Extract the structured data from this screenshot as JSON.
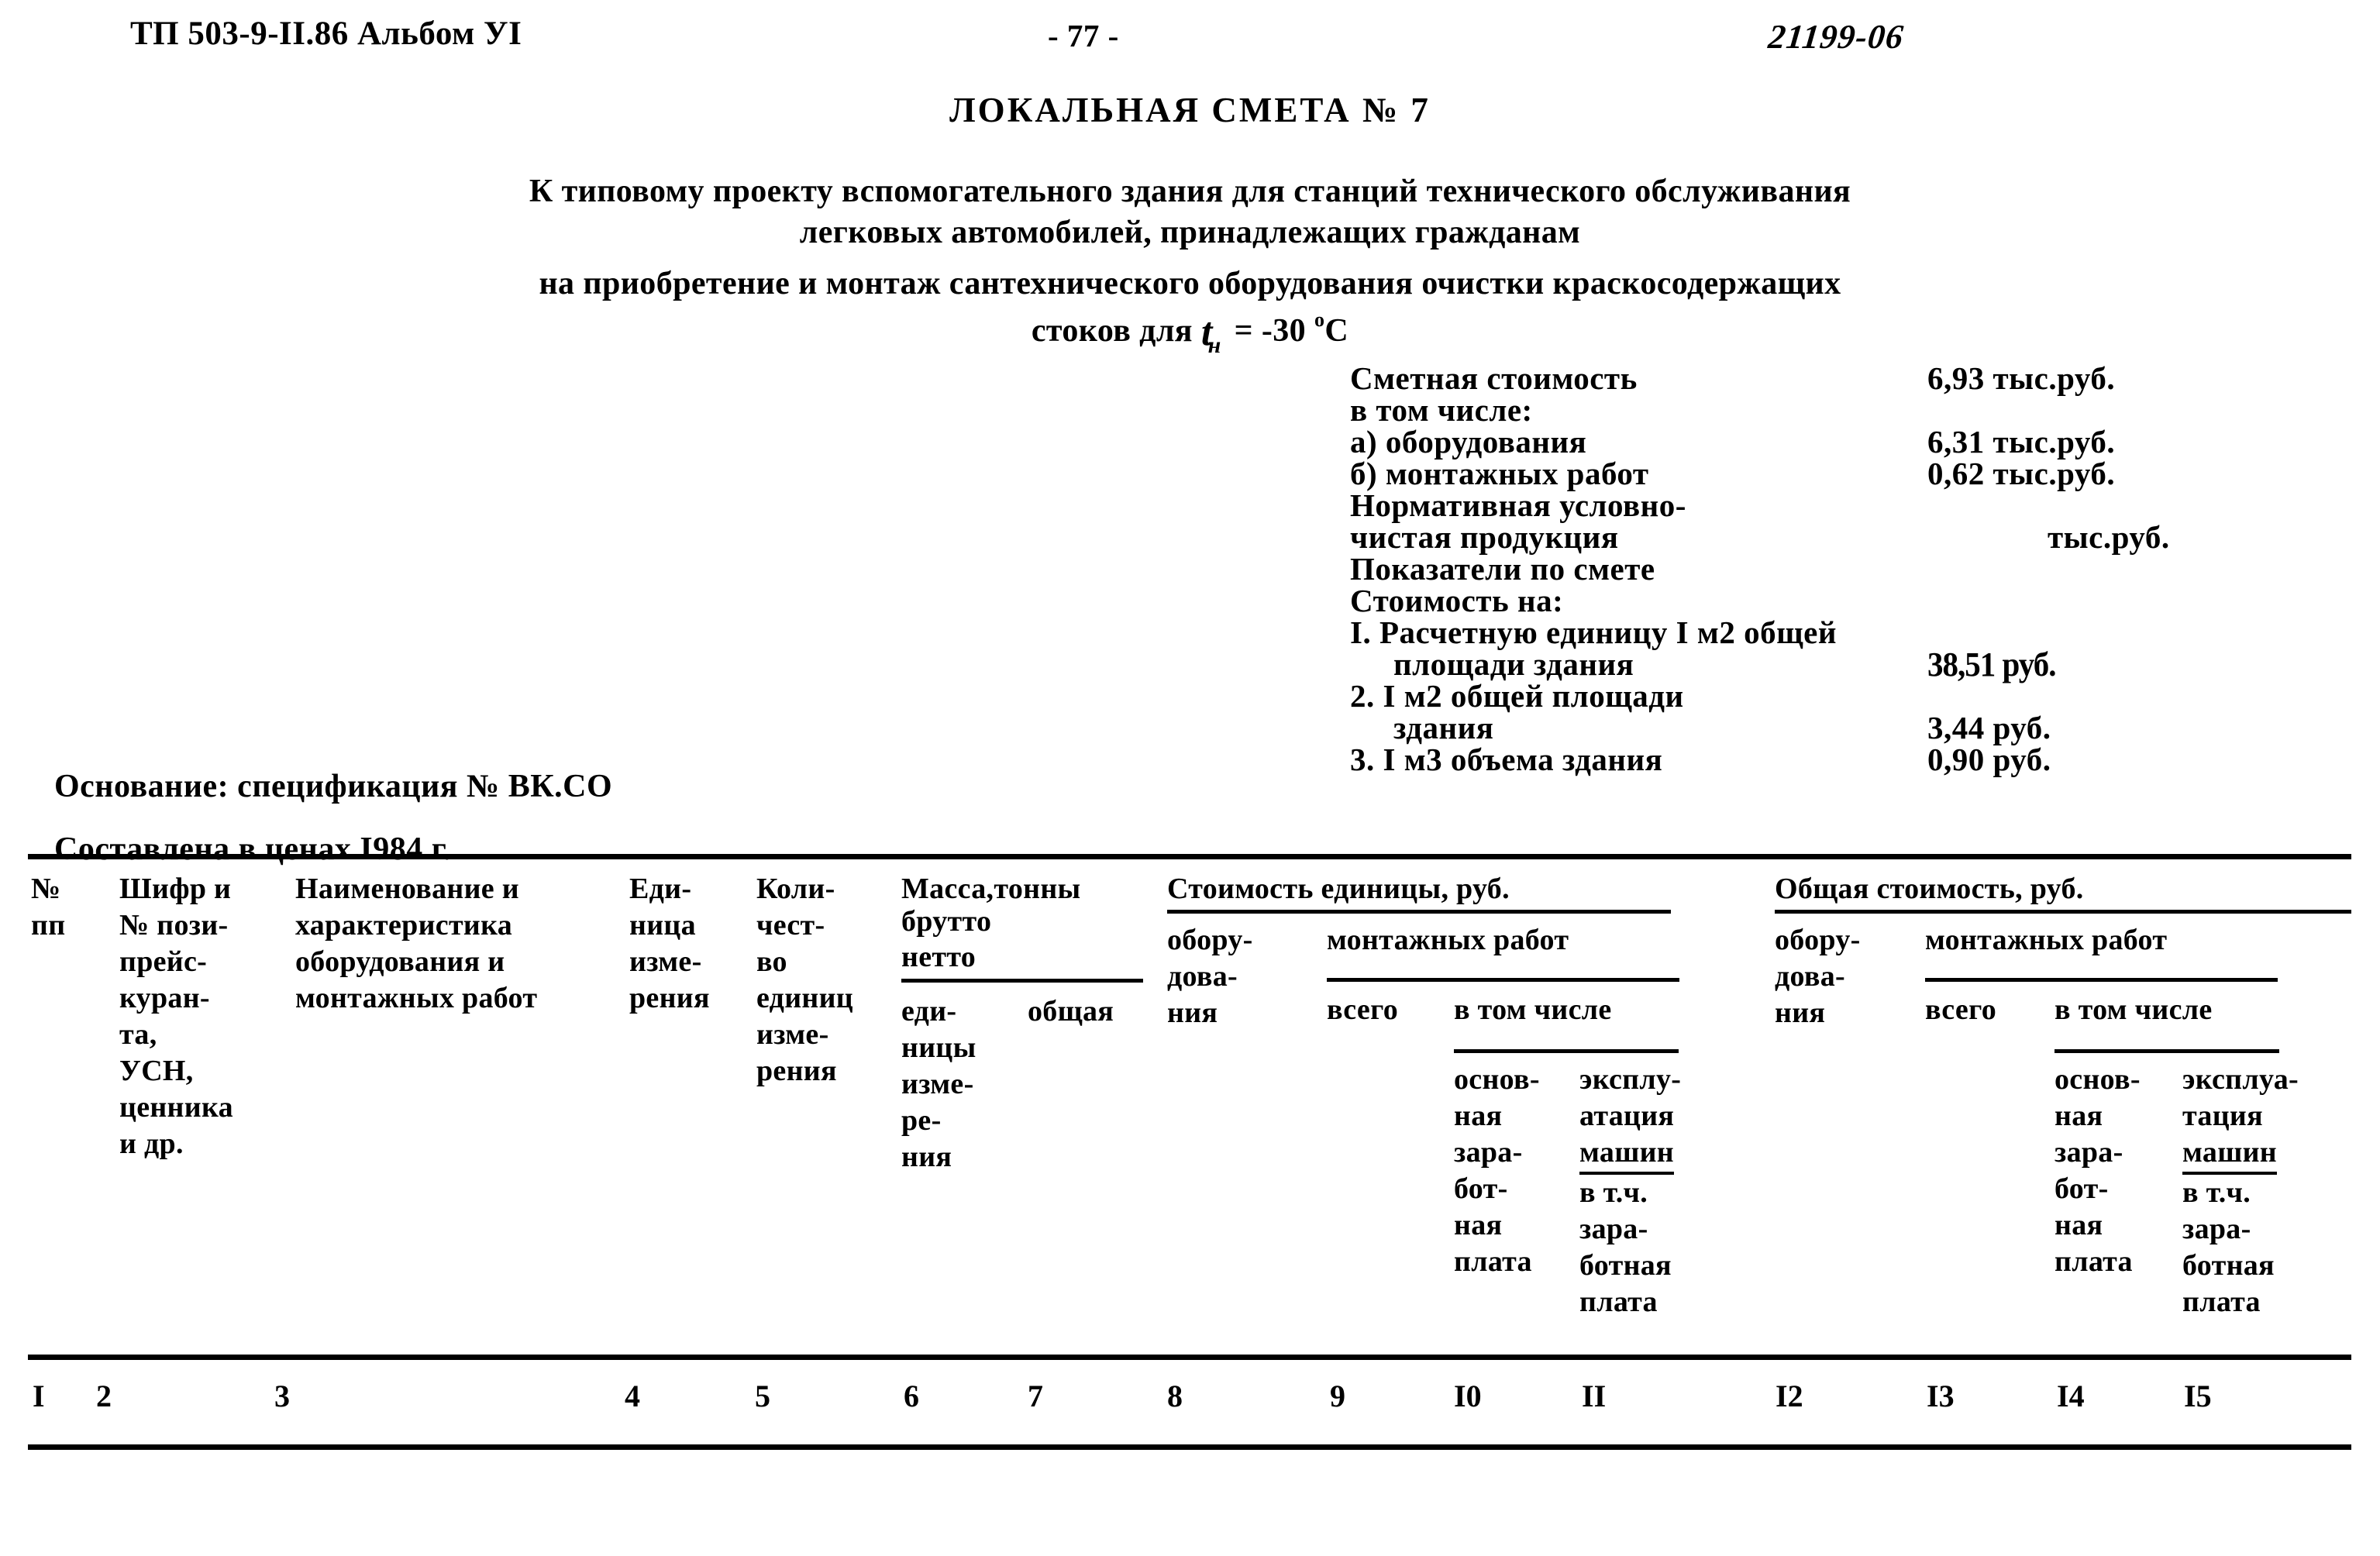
{
  "header": {
    "doc_code": "ТП 503-9-II.86 Альбом УI",
    "page_number": "- 77 -",
    "archive_number": "21199-06"
  },
  "title": "ЛОКАЛЬНАЯ СМЕТА № 7",
  "description": {
    "line1": "К типовому проекту вспомогательного здания для станций технического обслуживания",
    "line2": "легковых автомобилей, принадлежащих гражданам",
    "line3": "на приобретение и монтаж сантехнического оборудования очистки краскосодержащих",
    "line4_prefix": "стоков для ",
    "temp_symbol": "t",
    "temp_subscript": "н",
    "temp_equals": " = -30 ",
    "temp_degree": "о",
    "temp_unit": "С"
  },
  "cost_summary": {
    "rows": [
      {
        "label": "Сметная стоимость",
        "value": "6,93",
        "unit": "тыс.руб.",
        "style": "normal"
      },
      {
        "label": "в том числе:",
        "value": "",
        "unit": "",
        "style": "normal"
      },
      {
        "label": "а) оборудования",
        "value": "6,31",
        "unit": "тыс.руб.",
        "style": "normal"
      },
      {
        "label": "б) монтажных работ",
        "value": "0,62",
        "unit": "тыс.руб.",
        "style": "normal"
      },
      {
        "label": "Нормативная условно-",
        "value": "",
        "unit": "",
        "style": "normal"
      },
      {
        "label": "чистая продукция",
        "value": "",
        "unit": "тыс.руб.",
        "style": "unit-only"
      },
      {
        "label": "Показатели по смете",
        "value": "",
        "unit": "",
        "style": "normal"
      },
      {
        "label": "Стоимость на:",
        "value": "",
        "unit": "",
        "style": "normal"
      },
      {
        "label": "I. Расчетную единицу I м2 общей",
        "value": "",
        "unit": "",
        "style": "normal"
      },
      {
        "label": "площади здания",
        "value": "38,51",
        "unit": "руб.",
        "style": "handwritten",
        "indent": true
      },
      {
        "label": "2. I м2 общей площади",
        "value": "",
        "unit": "",
        "style": "normal"
      },
      {
        "label": "здания",
        "value": "3,44",
        "unit": "руб.",
        "style": "normal",
        "indent": true
      },
      {
        "label": "3. I м3 объема здания",
        "value": "0,90",
        "unit": "руб.",
        "style": "normal"
      }
    ]
  },
  "basis": {
    "line1": "Основание: спецификация № ВК.СО",
    "line2": "Составлена в ценах I984 г."
  },
  "table": {
    "columns": [
      {
        "number": "I",
        "header_lines": [
          "№",
          "пп"
        ]
      },
      {
        "number": "2",
        "header_lines": [
          "Шифр и",
          "№ пози-",
          "прейс-",
          "куран-",
          "та,",
          "УСН,",
          "ценника",
          "и др."
        ]
      },
      {
        "number": "3",
        "header_lines": [
          "Наименование и",
          "характеристика",
          "оборудования и",
          "монтажных работ"
        ]
      },
      {
        "number": "4",
        "header_lines": [
          "Еди-",
          "ница",
          "изме-",
          "рения"
        ]
      },
      {
        "number": "5",
        "header_lines": [
          "Коли-",
          "чест-",
          "во",
          "единиц",
          "изме-",
          "рения"
        ]
      },
      {
        "number": "6",
        "header_lines": [
          "еди-",
          "ницы",
          "изме-",
          "ре-",
          "ния"
        ]
      },
      {
        "number": "7",
        "header_lines": [
          "общая"
        ]
      },
      {
        "number": "8",
        "header_lines": [
          "обору-",
          "дова-",
          "ния"
        ]
      },
      {
        "number": "9",
        "header_lines": [
          "всего"
        ]
      },
      {
        "number": "I0",
        "header_lines": [
          "основ-",
          "ная",
          "зара-",
          "бот-",
          "ная",
          "плата"
        ]
      },
      {
        "number": "II",
        "header_lines": [
          "эксплу-",
          "атация",
          "машин",
          "в т.ч.",
          "зара-",
          "ботная",
          "плата"
        ]
      },
      {
        "number": "I2",
        "header_lines": [
          "обору-",
          "дова-",
          "ния"
        ]
      },
      {
        "number": "I3",
        "header_lines": [
          "всего"
        ]
      },
      {
        "number": "I4",
        "header_lines": [
          "основ-",
          "ная",
          "зара-",
          "бот-",
          "ная",
          "плата"
        ]
      },
      {
        "number": "I5",
        "header_lines": [
          "эксплуа-",
          "тация",
          "машин",
          "в т.ч.",
          "зара-",
          "ботная",
          "плата"
        ]
      }
    ],
    "group_headers": {
      "mass": "Масса,тонны",
      "mass_gross": "брутто",
      "mass_net": "нетто",
      "unit_cost": "Стоимость единицы, руб.",
      "total_cost": "Общая стоимость, руб.",
      "install_works": "монтажных работ",
      "in_which": "в том числе"
    }
  }
}
